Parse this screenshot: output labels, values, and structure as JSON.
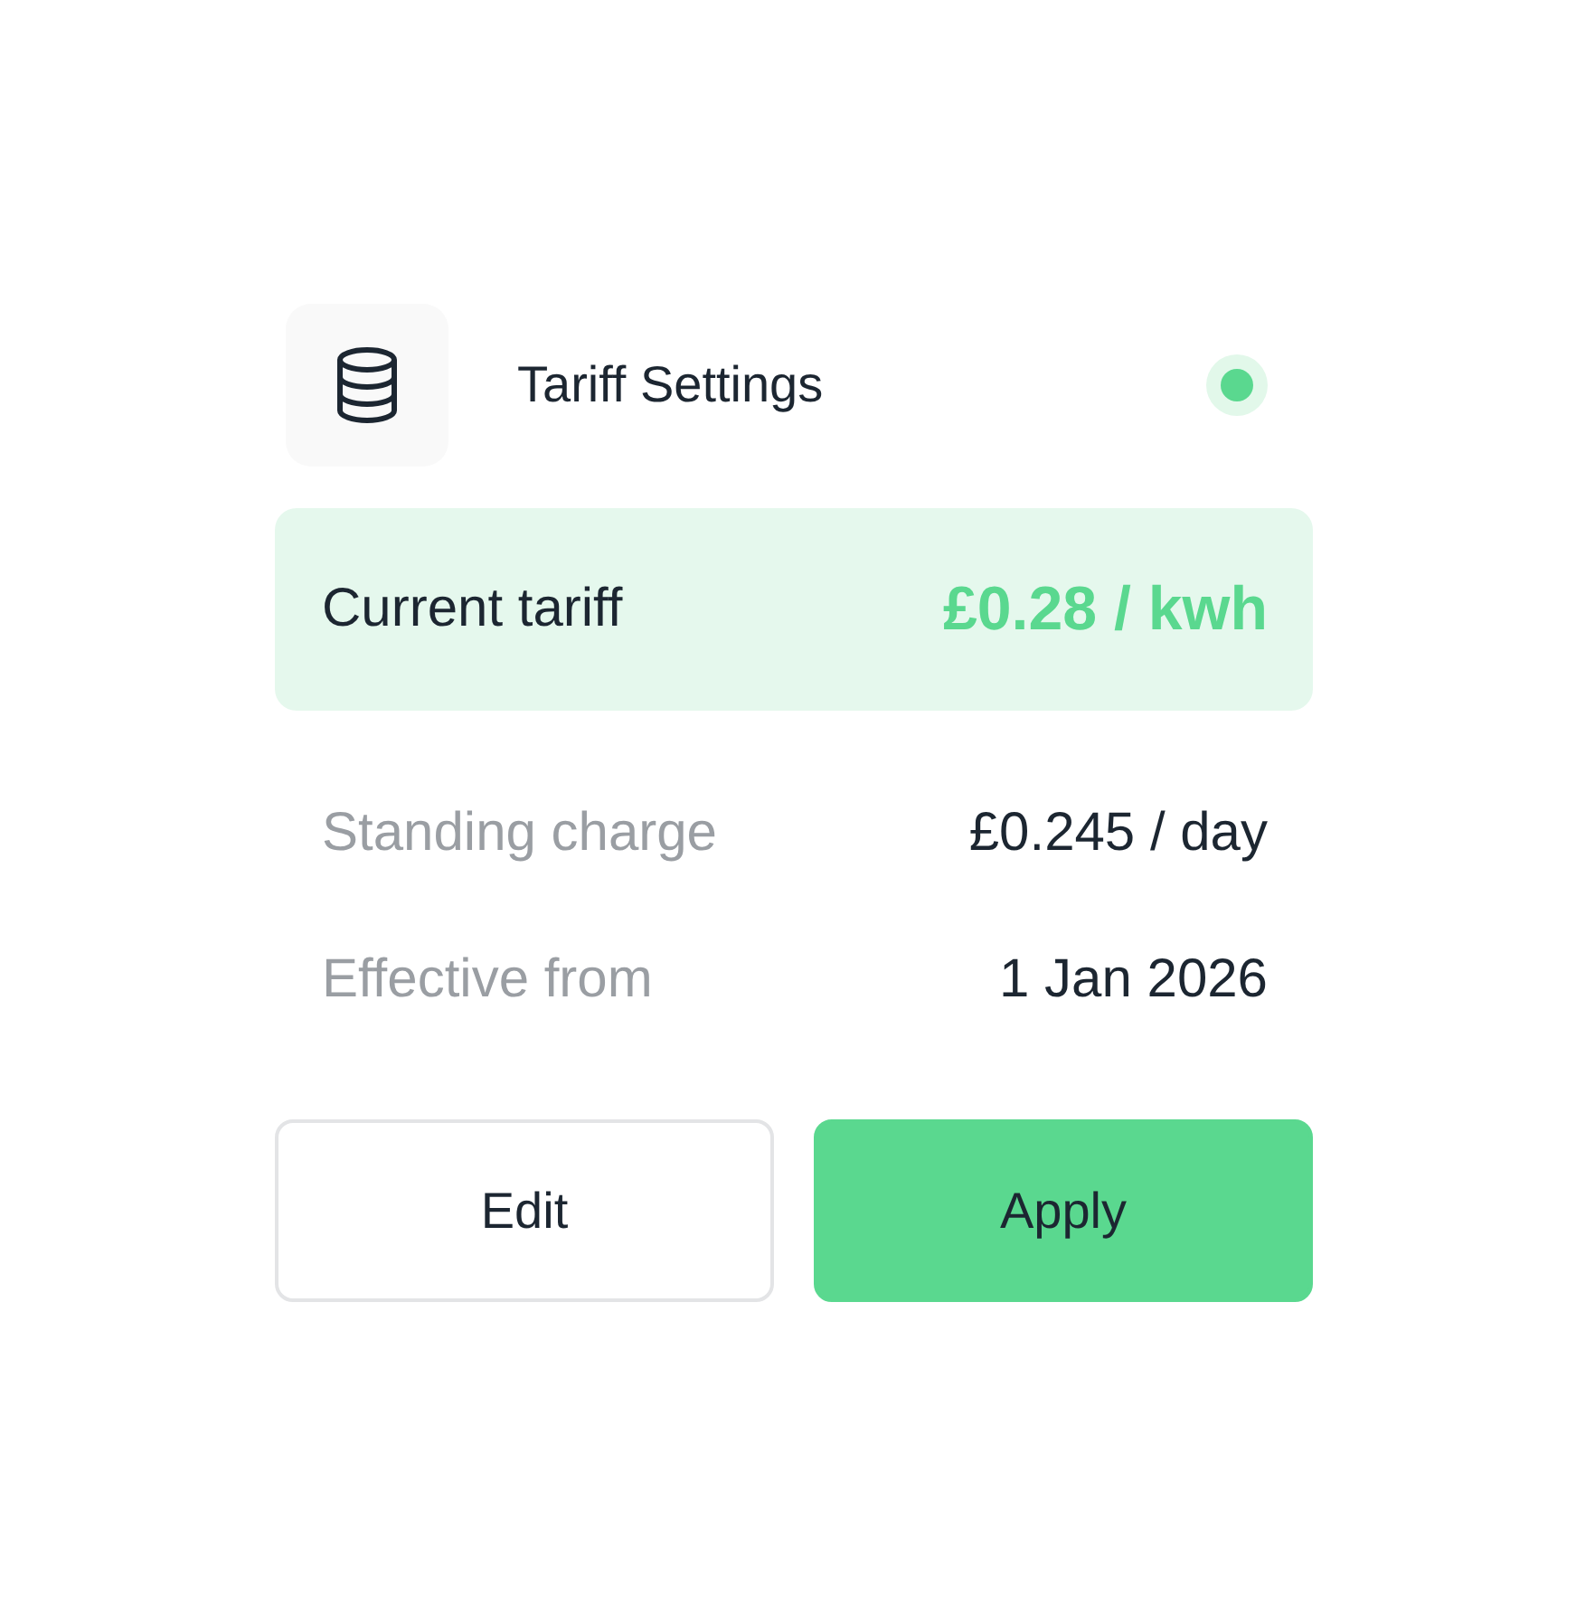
{
  "header": {
    "title": "Tariff Settings",
    "status_on": true
  },
  "current_tariff": {
    "label": "Current tariff",
    "value": "£0.28 / kwh"
  },
  "details": [
    {
      "label": "Standing charge",
      "value": "£0.245 / day"
    },
    {
      "label": "Effective from",
      "value": "1 Jan 2026"
    }
  ],
  "buttons": [
    {
      "label": "Edit",
      "kind": "secondary"
    },
    {
      "label": "Apply",
      "kind": "primary"
    }
  ]
}
